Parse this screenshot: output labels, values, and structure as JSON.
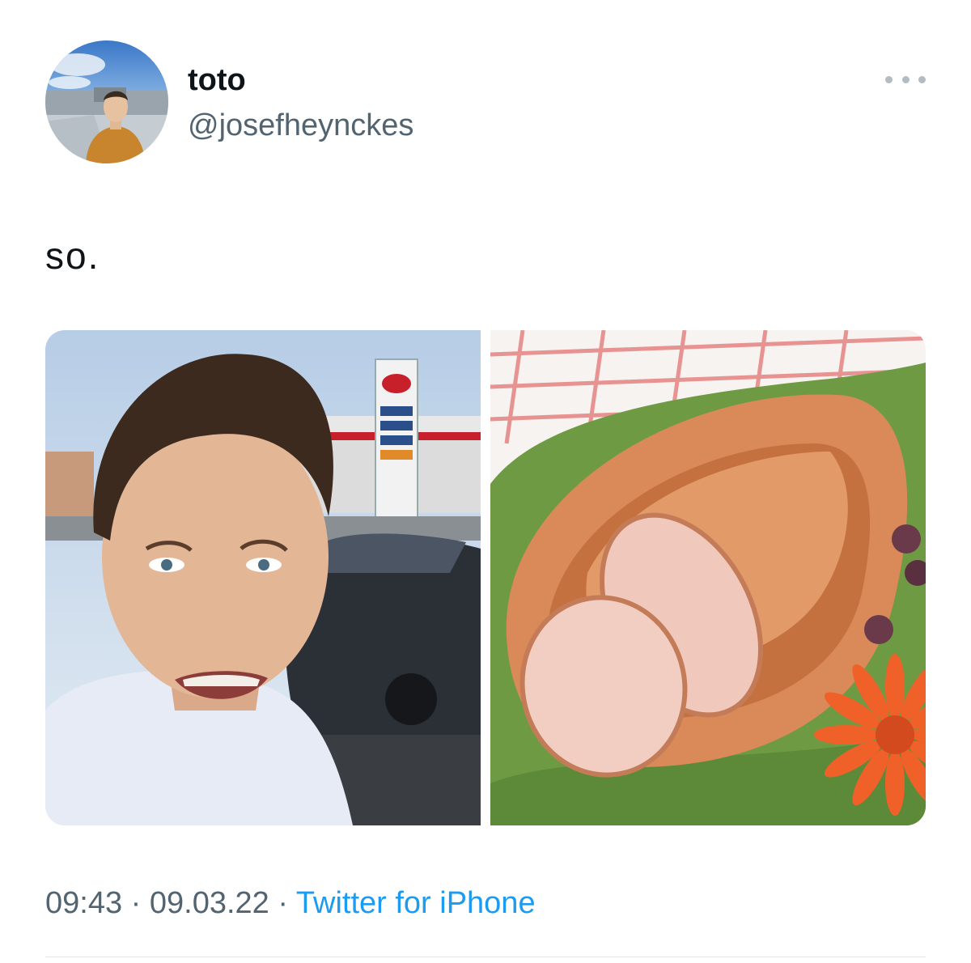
{
  "author": {
    "display_name": "toto",
    "handle": "@josefheynckes"
  },
  "tweet": {
    "text": "so.",
    "time": "09:43",
    "separator": "·",
    "date": "09.03.22",
    "source": "Twitter for iPhone"
  },
  "media": {
    "count": 2
  },
  "icons": {
    "more": "more-options-icon"
  },
  "colors": {
    "text_primary": "#0f1419",
    "text_secondary": "#536471",
    "link": "#1d9bf0"
  }
}
